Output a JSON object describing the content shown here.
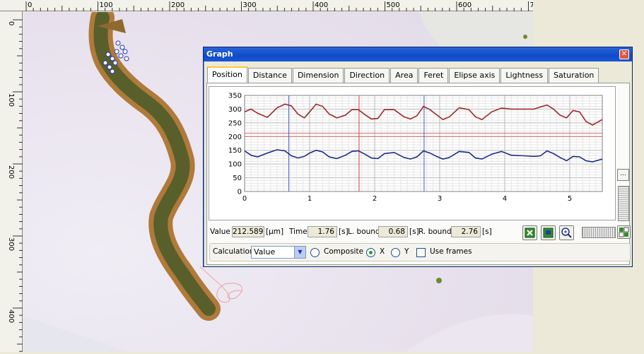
{
  "ruler": {
    "top_labels": [
      "0",
      "100",
      "200",
      "300",
      "400",
      "500",
      "600",
      "700"
    ],
    "left_labels": [
      "0",
      "100",
      "200",
      "300",
      "400"
    ]
  },
  "window": {
    "title": "Graph",
    "close_glyph": "✕",
    "tabs": [
      {
        "label": "Position",
        "active": true
      },
      {
        "label": "Distance"
      },
      {
        "label": "Dimension"
      },
      {
        "label": "Direction"
      },
      {
        "label": "Area"
      },
      {
        "label": "Feret"
      },
      {
        "label": "Elipse axis"
      },
      {
        "label": "Lightness"
      },
      {
        "label": "Saturation"
      }
    ]
  },
  "side": {
    "more_label": "..."
  },
  "readout": {
    "value_label": "Value",
    "value": "212.589",
    "value_unit": "[µm]",
    "time_label": "Time",
    "time": "1.76",
    "time_unit": "[s]",
    "lbound_label": "L. bound",
    "lbound": "0.68",
    "lbound_unit": "[s]",
    "rbound_label": "R. bound",
    "rbound": "2.76",
    "rbound_unit": "[s]"
  },
  "calc": {
    "label": "Calculation",
    "selected": "Value",
    "composite_label": "Composite",
    "x_label": "X",
    "y_label": "Y",
    "use_frames_label": "Use frames",
    "selected_radio": "X",
    "use_frames_checked": false
  },
  "colors": {
    "series_x": "#a0262b",
    "series_y": "#1c2a8c",
    "cursor": "#d44040",
    "bound": "#4a5cc4"
  },
  "chart_data": {
    "type": "line",
    "xlim": [
      0,
      5.5
    ],
    "ylim": [
      0,
      350
    ],
    "x_ticks": [
      "0",
      "1",
      "2",
      "3",
      "4",
      "5"
    ],
    "y_ticks": [
      "0",
      "50",
      "100",
      "150",
      "200",
      "250",
      "300",
      "350"
    ],
    "series": [
      {
        "x": [
          0,
          0.1,
          0.2,
          0.35,
          0.5,
          0.62,
          0.72,
          0.82,
          0.92,
          1.0,
          1.1,
          1.2,
          1.3,
          1.42,
          1.55,
          1.65,
          1.75,
          1.85,
          1.95,
          2.05,
          2.15,
          2.3,
          2.45,
          2.55,
          2.65,
          2.75,
          2.85,
          2.95,
          3.05,
          3.15,
          3.3,
          3.45,
          3.55,
          3.65,
          3.8,
          3.95,
          4.1,
          4.3,
          4.45,
          4.55,
          4.65,
          4.75,
          4.85,
          4.95,
          5.05,
          5.15,
          5.25,
          5.35,
          5.5
        ],
        "values": [
          290,
          300,
          285,
          270,
          305,
          318,
          312,
          282,
          268,
          290,
          318,
          310,
          282,
          268,
          278,
          298,
          298,
          280,
          264,
          266,
          298,
          298,
          272,
          264,
          276,
          310,
          298,
          280,
          262,
          272,
          305,
          298,
          272,
          262,
          290,
          304,
          300,
          300,
          300,
          308,
          315,
          300,
          278,
          268,
          295,
          290,
          255,
          242,
          262
        ]
      },
      {
        "x": [
          0,
          0.1,
          0.2,
          0.35,
          0.5,
          0.62,
          0.72,
          0.82,
          0.92,
          1.0,
          1.1,
          1.2,
          1.3,
          1.42,
          1.55,
          1.65,
          1.75,
          1.85,
          1.95,
          2.05,
          2.15,
          2.3,
          2.45,
          2.55,
          2.65,
          2.75,
          2.85,
          2.95,
          3.05,
          3.15,
          3.3,
          3.45,
          3.55,
          3.65,
          3.8,
          3.95,
          4.1,
          4.3,
          4.45,
          4.55,
          4.65,
          4.75,
          4.85,
          4.95,
          5.05,
          5.15,
          5.25,
          5.35,
          5.5
        ],
        "values": [
          148,
          132,
          126,
          140,
          152,
          148,
          130,
          122,
          128,
          140,
          150,
          144,
          126,
          120,
          132,
          146,
          148,
          136,
          122,
          120,
          138,
          142,
          124,
          118,
          126,
          148,
          140,
          128,
          118,
          124,
          146,
          142,
          122,
          118,
          136,
          146,
          132,
          130,
          128,
          130,
          148,
          138,
          124,
          112,
          128,
          126,
          112,
          108,
          118
        ]
      }
    ],
    "hlines": [
      212.589,
      200
    ],
    "cursor_x": 1.76,
    "bounds_x": [
      0.68,
      2.76
    ],
    "grid": true
  }
}
